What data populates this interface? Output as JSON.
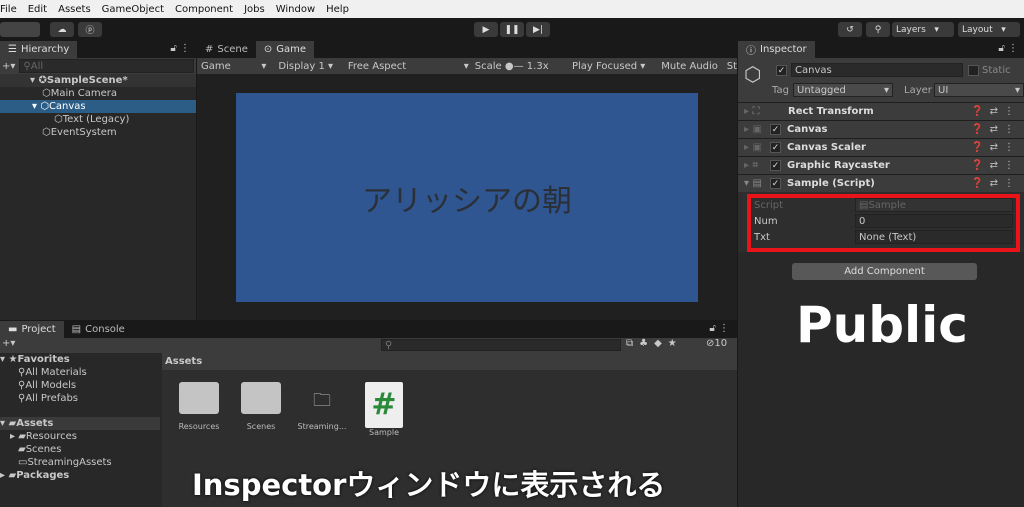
{
  "menu": [
    "File",
    "Edit",
    "Assets",
    "GameObject",
    "Component",
    "Jobs",
    "Window",
    "Help"
  ],
  "toolbar": {
    "layers": "Layers",
    "layout": "Layout"
  },
  "hierarchy": {
    "tab": "Hierarchy",
    "search_placeholder": "All",
    "items": [
      {
        "label": "SampleScene*"
      },
      {
        "label": "Main Camera"
      },
      {
        "label": "Canvas"
      },
      {
        "label": "Text (Legacy)"
      },
      {
        "label": "EventSystem"
      }
    ]
  },
  "game": {
    "tabs": [
      "Scene",
      "Game"
    ],
    "mode": "Game",
    "display": "Display 1",
    "aspect": "Free Aspect",
    "scale_label": "Scale",
    "scale_value": "1.3x",
    "play_focused": "Play Focused",
    "mute": "Mute Audio",
    "stats": "St",
    "screen_text": "アリッシアの朝",
    "screen_color": "#2f5690"
  },
  "inspector": {
    "tab": "Inspector",
    "name": "Canvas",
    "static": "Static",
    "tag_label": "Tag",
    "tag": "Untagged",
    "layer_label": "Layer",
    "layer": "UI",
    "components": [
      "Rect Transform",
      "Canvas",
      "Canvas Scaler",
      "Graphic Raycaster",
      "Sample (Script)"
    ],
    "fields": [
      {
        "label": "Script",
        "value": "Sample"
      },
      {
        "label": "Num",
        "value": "0"
      },
      {
        "label": "Txt",
        "value": "None (Text)"
      }
    ],
    "add_component": "Add Component",
    "highlight_color": "#e8141a"
  },
  "project": {
    "tabs": [
      "Project",
      "Console"
    ],
    "hidden_count": "10",
    "favorites": "Favorites",
    "fav_items": [
      "All Materials",
      "All Models",
      "All Prefabs"
    ],
    "assets_root": "Assets",
    "asset_tree": [
      "Resources",
      "Scenes",
      "StreamingAssets"
    ],
    "packages": "Packages",
    "breadcrumb": "Assets",
    "assets": [
      "Resources",
      "Scenes",
      "Streaming...",
      "Sample"
    ]
  },
  "captions": {
    "public": "Public",
    "bottom": "Inspectorウィンドウに表示される"
  }
}
